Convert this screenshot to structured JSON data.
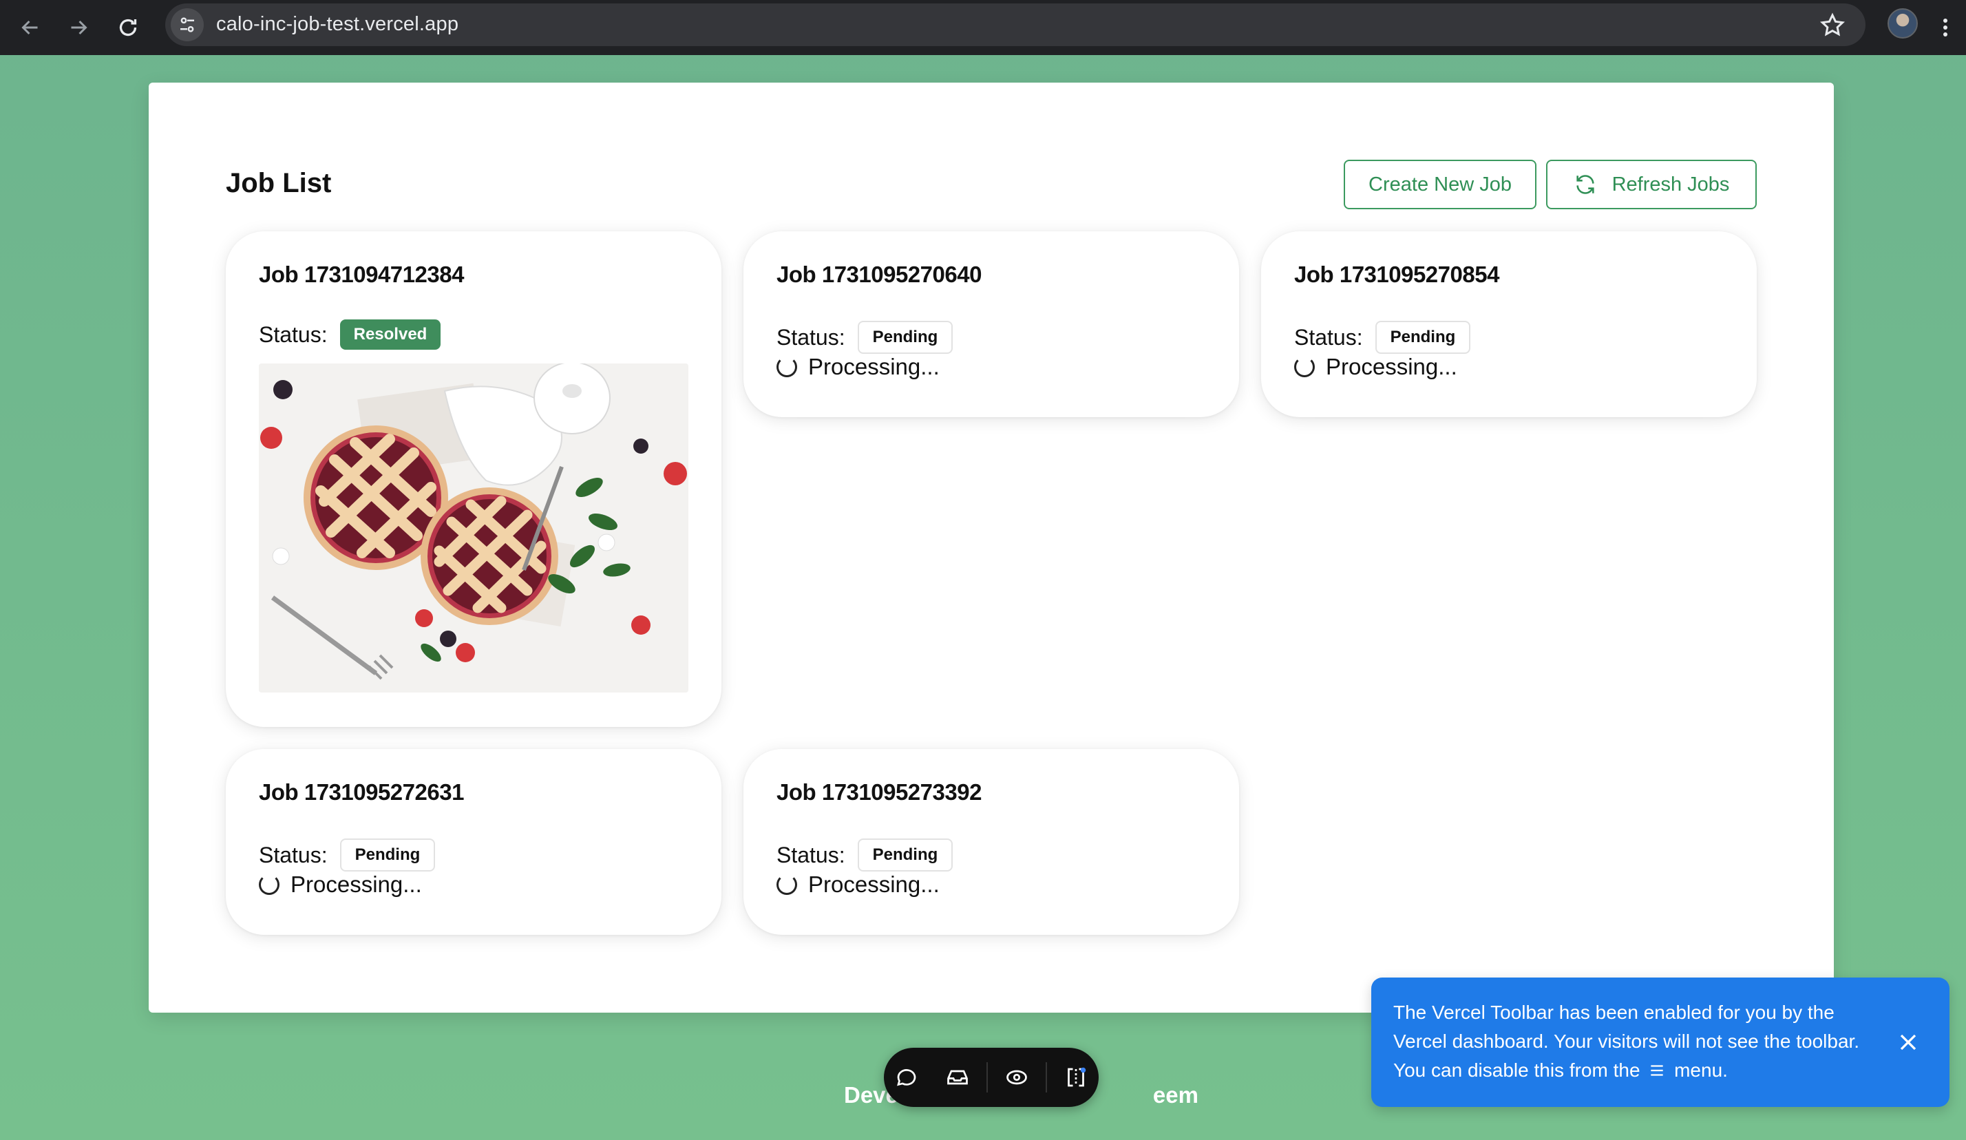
{
  "browser": {
    "url": "calo-inc-job-test.vercel.app"
  },
  "page": {
    "title": "Job List",
    "create_button": "Create New Job",
    "refresh_button": "Refresh Jobs",
    "status_label": "Status:",
    "processing_text": "Processing..."
  },
  "jobs": [
    {
      "title": "Job 1731094712384",
      "status": "Resolved",
      "has_image": true,
      "image_alt": "pies with berries"
    },
    {
      "title": "Job 1731095270640",
      "status": "Pending"
    },
    {
      "title": "Job 1731095270854",
      "status": "Pending"
    },
    {
      "title": "Job 1731095272631",
      "status": "Pending"
    },
    {
      "title": "Job 1731095273392",
      "status": "Pending"
    }
  ],
  "footer": {
    "text_left": "Deve",
    "text_right": "eem"
  },
  "toast": {
    "message_part1": "The Vercel Toolbar has been enabled for you by the Vercel dashboard. Your visitors will not see the toolbar. You can disable this from the",
    "message_part2": "menu."
  },
  "colors": {
    "accent": "#3c9a5f",
    "resolved_badge": "#3f8d5c",
    "toast": "#1f7be8",
    "background": "#77c08e"
  }
}
